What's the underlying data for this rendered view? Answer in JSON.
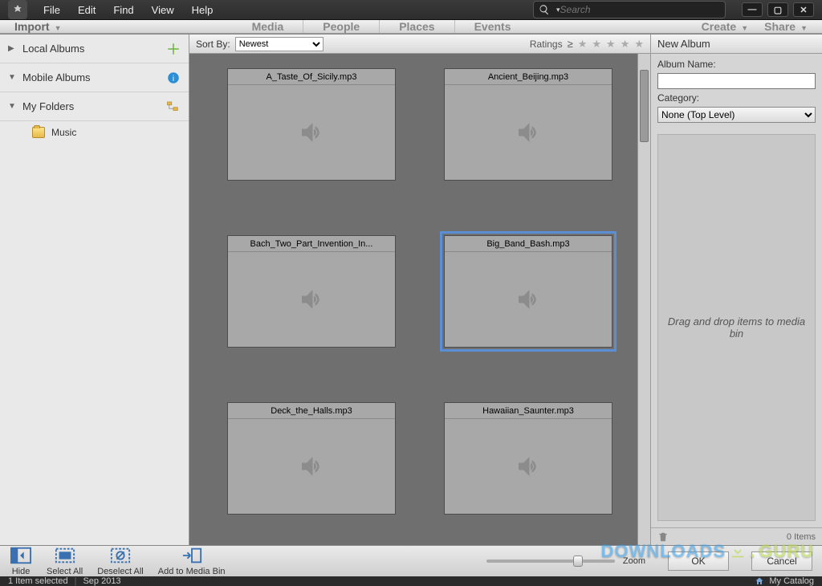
{
  "menu": {
    "file": "File",
    "edit": "Edit",
    "find": "Find",
    "view": "View",
    "help": "Help"
  },
  "search": {
    "placeholder": "Search"
  },
  "secbar": {
    "import": "Import",
    "tabs": [
      "Media",
      "People",
      "Places",
      "Events"
    ],
    "create": "Create",
    "share": "Share"
  },
  "left": {
    "local": "Local Albums",
    "mobile": "Mobile Albums",
    "folders": "My Folders",
    "music": "Music"
  },
  "sort": {
    "label": "Sort By:",
    "value": "Newest",
    "ratings": "Ratings"
  },
  "thumbs": [
    {
      "name": "A_Taste_Of_Sicily.mp3",
      "selected": false
    },
    {
      "name": "Ancient_Beijing.mp3",
      "selected": false
    },
    {
      "name": "Bach_Two_Part_Invention_In...",
      "selected": false
    },
    {
      "name": "Big_Band_Bash.mp3",
      "selected": true
    },
    {
      "name": "Deck_the_Halls.mp3",
      "selected": false
    },
    {
      "name": "Hawaiian_Saunter.mp3",
      "selected": false
    }
  ],
  "right": {
    "title": "New Album",
    "albumname_label": "Album Name:",
    "albumname_value": "",
    "category_label": "Category:",
    "category_value": "None (Top Level)",
    "dropzone": "Drag and drop items to media bin",
    "items": "0 Items"
  },
  "bottom": {
    "hide": "Hide",
    "selectall": "Select All",
    "deselectall": "Deselect All",
    "addtobin": "Add to Media Bin",
    "zoom": "Zoom",
    "ok": "OK",
    "cancel": "Cancel"
  },
  "status": {
    "selected": "1 Item selected",
    "date": "Sep 2013",
    "catalog": "My Catalog"
  },
  "watermark": {
    "dl": "DOWNLOADS",
    "guru": "GURU"
  }
}
